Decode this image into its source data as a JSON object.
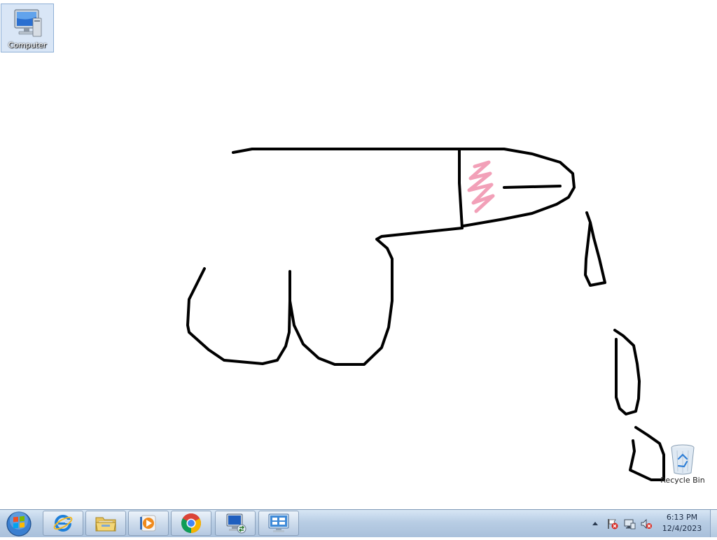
{
  "desktop": {
    "icons": {
      "computer": {
        "label": "Computer",
        "icon": "computer-icon"
      },
      "recycle_bin": {
        "label": "Recycle Bin",
        "icon": "recycle-bin-icon"
      }
    },
    "background_color": "#ffffff",
    "drawing": {
      "stroke_color": "#000000",
      "highlight_color": "#f2a0b8"
    }
  },
  "taskbar": {
    "start_button": "start-orb-icon",
    "pinned": [
      {
        "name": "internet-explorer-icon"
      },
      {
        "name": "file-explorer-icon"
      },
      {
        "name": "media-player-icon"
      },
      {
        "name": "chrome-icon"
      },
      {
        "name": "remote-desktop-icon"
      },
      {
        "name": "control-panel-icon"
      }
    ],
    "tray": {
      "icons": [
        "show-hidden-icons-arrow",
        "action-center-flag-icon",
        "network-icon",
        "volume-muted-icon"
      ]
    },
    "clock": {
      "time": "6:13 PM",
      "date": "12/4/2023"
    }
  }
}
